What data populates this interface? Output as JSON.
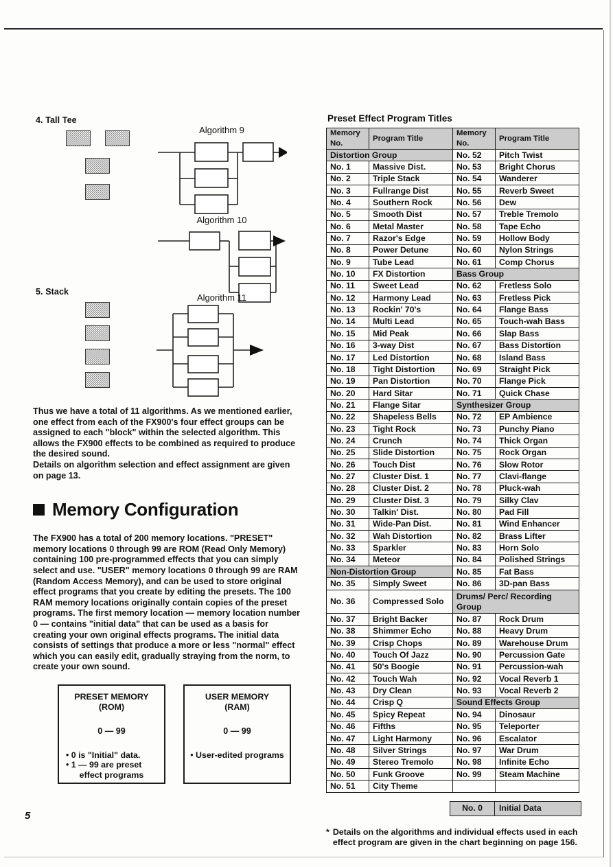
{
  "page": {
    "number": "5"
  },
  "left": {
    "shapes": [
      {
        "index": "4.",
        "name": "4. Tall Tee"
      },
      {
        "index": "5.",
        "name": "5. Stack"
      }
    ],
    "algorithms": [
      {
        "title": "Algorithm 9"
      },
      {
        "title": "Algorithm 10"
      },
      {
        "title": "Algorithm 11"
      }
    ],
    "paragraphs": [
      "Thus we have a total of 11 algorithms. As we mentioned earlier, one effect from each of the FX900's four effect groups can be assigned to each \"block\" within the selected algorithm. This allows the FX900 effects to be combined as required to produce the desired sound.",
      "Details on algorithm selection and effect assignment are given on page 13."
    ],
    "section": {
      "heading": "Memory Configuration",
      "body": "The FX900 has a total of 200 memory locations. \"PRESET\" memory locations 0 through 99 are ROM (Read Only Memory) containing 100 pre-programmed effects that you can simply select and use. \"USER\" memory locations 0 through 99 are RAM (Random Access Memory), and can be used to store original effect programs that you create by editing the presets. The 100 RAM memory locations originally contain copies of the preset programs. The first memory location — memory location number 0 — contains \"initial data\" that can be used as a basis for creating your own original effects programs. The initial data consists of settings that produce a more or less \"normal\" effect which you can easily edit, gradually straying from the norm, to create your own sound."
    },
    "memory_boxes": [
      {
        "title_line1": "PRESET MEMORY",
        "title_line2": "(ROM)",
        "range": "0 — 99",
        "bullets": [
          "• 0 is \"Initial\" data.",
          "• 1 — 99 are preset",
          "effect programs"
        ]
      },
      {
        "title_line1": "USER MEMORY",
        "title_line2": "(RAM)",
        "range": "0 — 99",
        "bullets": [
          "• User-edited programs"
        ]
      }
    ]
  },
  "right": {
    "table_title": "Preset Effect Program Titles",
    "headers": {
      "memory_no_line1": "Memory",
      "memory_no_line2": "No.",
      "program_title": "Program Title"
    },
    "left_column": [
      {
        "type": "group",
        "label": "Distortion Group"
      },
      {
        "type": "item",
        "no": "No. 1",
        "title": "Massive Dist."
      },
      {
        "type": "item",
        "no": "No. 2",
        "title": "Triple Stack"
      },
      {
        "type": "item",
        "no": "No. 3",
        "title": "Fullrange Dist"
      },
      {
        "type": "item",
        "no": "No. 4",
        "title": "Southern Rock"
      },
      {
        "type": "item",
        "no": "No. 5",
        "title": "Smooth Dist"
      },
      {
        "type": "item",
        "no": "No. 6",
        "title": "Metal Master"
      },
      {
        "type": "item",
        "no": "No. 7",
        "title": "Razor's Edge"
      },
      {
        "type": "item",
        "no": "No. 8",
        "title": "Power Detune"
      },
      {
        "type": "item",
        "no": "No. 9",
        "title": "Tube Lead"
      },
      {
        "type": "item",
        "no": "No. 10",
        "title": "FX Distortion"
      },
      {
        "type": "item",
        "no": "No. 11",
        "title": "Sweet Lead"
      },
      {
        "type": "item",
        "no": "No. 12",
        "title": "Harmony Lead"
      },
      {
        "type": "item",
        "no": "No. 13",
        "title": "Rockin' 70's"
      },
      {
        "type": "item",
        "no": "No. 14",
        "title": "Multi Lead"
      },
      {
        "type": "item",
        "no": "No. 15",
        "title": "Mid Peak"
      },
      {
        "type": "item",
        "no": "No. 16",
        "title": "3-way Dist"
      },
      {
        "type": "item",
        "no": "No. 17",
        "title": "Led Distortion"
      },
      {
        "type": "item",
        "no": "No. 18",
        "title": "Tight Distortion"
      },
      {
        "type": "item",
        "no": "No. 19",
        "title": "Pan Distortion"
      },
      {
        "type": "item",
        "no": "No. 20",
        "title": "Hard Sitar"
      },
      {
        "type": "item",
        "no": "No. 21",
        "title": "Flange Sitar"
      },
      {
        "type": "item",
        "no": "No. 22",
        "title": "Shapeless Bells"
      },
      {
        "type": "item",
        "no": "No. 23",
        "title": "Tight Rock"
      },
      {
        "type": "item",
        "no": "No. 24",
        "title": "Crunch"
      },
      {
        "type": "item",
        "no": "No. 25",
        "title": "Slide Distortion"
      },
      {
        "type": "item",
        "no": "No. 26",
        "title": "Touch Dist"
      },
      {
        "type": "item",
        "no": "No. 27",
        "title": "Cluster Dist. 1"
      },
      {
        "type": "item",
        "no": "No. 28",
        "title": "Cluster Dist. 2"
      },
      {
        "type": "item",
        "no": "No. 29",
        "title": "Cluster Dist. 3"
      },
      {
        "type": "item",
        "no": "No. 30",
        "title": "Talkin' Dist."
      },
      {
        "type": "item",
        "no": "No. 31",
        "title": "Wide-Pan Dist."
      },
      {
        "type": "item",
        "no": "No. 32",
        "title": "Wah Distortion"
      },
      {
        "type": "item",
        "no": "No. 33",
        "title": "Sparkler"
      },
      {
        "type": "item",
        "no": "No. 34",
        "title": "Meteor"
      },
      {
        "type": "group",
        "label": "Non-Distortion Group"
      },
      {
        "type": "item",
        "no": "No. 35",
        "title": "Simply Sweet"
      },
      {
        "type": "item",
        "no": "No. 36",
        "title": "Compressed Solo"
      },
      {
        "type": "item",
        "no": "No. 37",
        "title": "Bright Backer"
      },
      {
        "type": "item",
        "no": "No. 38",
        "title": "Shimmer Echo"
      },
      {
        "type": "item",
        "no": "No. 39",
        "title": "Crisp Chops"
      },
      {
        "type": "item",
        "no": "No. 40",
        "title": "Touch Of Jazz"
      },
      {
        "type": "item",
        "no": "No. 41",
        "title": "50's Boogie"
      },
      {
        "type": "item",
        "no": "No. 42",
        "title": "Touch Wah"
      },
      {
        "type": "item",
        "no": "No. 43",
        "title": "Dry Clean"
      },
      {
        "type": "item",
        "no": "No. 44",
        "title": "Crisp Q"
      },
      {
        "type": "item",
        "no": "No. 45",
        "title": "Spicy Repeat"
      },
      {
        "type": "item",
        "no": "No. 46",
        "title": "Fifths"
      },
      {
        "type": "item",
        "no": "No. 47",
        "title": "Light Harmony"
      },
      {
        "type": "item",
        "no": "No. 48",
        "title": "Silver Strings"
      },
      {
        "type": "item",
        "no": "No. 49",
        "title": "Stereo Tremolo"
      },
      {
        "type": "item",
        "no": "No. 50",
        "title": "Funk Groove"
      },
      {
        "type": "item",
        "no": "No. 51",
        "title": "City Theme"
      }
    ],
    "right_column": [
      {
        "type": "item",
        "no": "No. 52",
        "title": "Pitch Twist"
      },
      {
        "type": "item",
        "no": "No. 53",
        "title": "Bright Chorus"
      },
      {
        "type": "item",
        "no": "No. 54",
        "title": "Wanderer"
      },
      {
        "type": "item",
        "no": "No. 55",
        "title": "Reverb Sweet"
      },
      {
        "type": "item",
        "no": "No. 56",
        "title": "Dew"
      },
      {
        "type": "item",
        "no": "No. 57",
        "title": "Treble Tremolo"
      },
      {
        "type": "item",
        "no": "No. 58",
        "title": "Tape Echo"
      },
      {
        "type": "item",
        "no": "No. 59",
        "title": "Hollow Body"
      },
      {
        "type": "item",
        "no": "No. 60",
        "title": "Nylon Strings"
      },
      {
        "type": "item",
        "no": "No. 61",
        "title": "Comp Chorus"
      },
      {
        "type": "group",
        "label": "Bass Group"
      },
      {
        "type": "item",
        "no": "No. 62",
        "title": "Fretless Solo"
      },
      {
        "type": "item",
        "no": "No. 63",
        "title": "Fretless Pick"
      },
      {
        "type": "item",
        "no": "No. 64",
        "title": "Flange Bass"
      },
      {
        "type": "item",
        "no": "No. 65",
        "title": "Touch-wah Bass"
      },
      {
        "type": "item",
        "no": "No. 66",
        "title": "Slap Bass"
      },
      {
        "type": "item",
        "no": "No. 67",
        "title": "Bass Distortion"
      },
      {
        "type": "item",
        "no": "No. 68",
        "title": "Island Bass"
      },
      {
        "type": "item",
        "no": "No. 69",
        "title": "Straight Pick"
      },
      {
        "type": "item",
        "no": "No. 70",
        "title": "Flange Pick"
      },
      {
        "type": "item",
        "no": "No. 71",
        "title": "Quick Chase"
      },
      {
        "type": "group",
        "label": "Synthesizer Group"
      },
      {
        "type": "item",
        "no": "No. 72",
        "title": "EP Ambience"
      },
      {
        "type": "item",
        "no": "No. 73",
        "title": "Punchy Piano"
      },
      {
        "type": "item",
        "no": "No. 74",
        "title": "Thick Organ"
      },
      {
        "type": "item",
        "no": "No. 75",
        "title": "Rock Organ"
      },
      {
        "type": "item",
        "no": "No. 76",
        "title": "Slow Rotor"
      },
      {
        "type": "item",
        "no": "No. 77",
        "title": "Clavi-flange"
      },
      {
        "type": "item",
        "no": "No. 78",
        "title": "Pluck-wah"
      },
      {
        "type": "item",
        "no": "No. 79",
        "title": "Silky Clav"
      },
      {
        "type": "item",
        "no": "No. 80",
        "title": "Pad Fill"
      },
      {
        "type": "item",
        "no": "No. 81",
        "title": "Wind Enhancer"
      },
      {
        "type": "item",
        "no": "No. 82",
        "title": "Brass Lifter"
      },
      {
        "type": "item",
        "no": "No. 83",
        "title": "Horn Solo"
      },
      {
        "type": "item",
        "no": "No. 84",
        "title": "Polished Strings"
      },
      {
        "type": "item",
        "no": "No. 85",
        "title": "Fat Bass"
      },
      {
        "type": "item",
        "no": "No. 86",
        "title": "3D-pan Bass"
      },
      {
        "type": "group2",
        "label": "Drums/ Perc/ Recording Group"
      },
      {
        "type": "item",
        "no": "No. 87",
        "title": "Rock Drum"
      },
      {
        "type": "item",
        "no": "No. 88",
        "title": "Heavy Drum"
      },
      {
        "type": "item",
        "no": "No. 89",
        "title": "Warehouse Drum"
      },
      {
        "type": "item",
        "no": "No. 90",
        "title": "Percussion Gate"
      },
      {
        "type": "item",
        "no": "No. 91",
        "title": "Percussion-wah"
      },
      {
        "type": "item",
        "no": "No. 92",
        "title": "Vocal Reverb 1"
      },
      {
        "type": "item",
        "no": "No. 93",
        "title": "Vocal Reverb 2"
      },
      {
        "type": "group",
        "label": "Sound Effects Group"
      },
      {
        "type": "item",
        "no": "No. 94",
        "title": "Dinosaur"
      },
      {
        "type": "item",
        "no": "No. 95",
        "title": "Teleporter"
      },
      {
        "type": "item",
        "no": "No. 96",
        "title": "Escalator"
      },
      {
        "type": "item",
        "no": "No. 97",
        "title": "War Drum"
      },
      {
        "type": "item",
        "no": "No. 98",
        "title": "Infinite Echo"
      },
      {
        "type": "item",
        "no": "No. 99",
        "title": "Steam Machine"
      }
    ],
    "initial_row": {
      "no": "No. 0",
      "title": "Initial Data"
    },
    "footnote": {
      "marker": "*",
      "text": "Details on the algorithms and individual effects used in each effect program are given in the chart beginning on page 156."
    }
  }
}
